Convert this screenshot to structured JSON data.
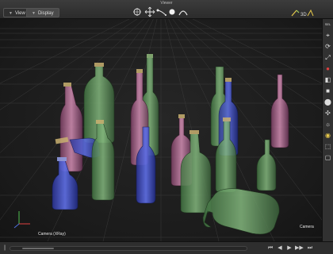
{
  "window": {
    "title": "Viewer"
  },
  "tabs": [
    {
      "label": "View"
    },
    {
      "label": "Display"
    }
  ],
  "toolbar": {
    "tools": [
      {
        "name": "orbit"
      },
      {
        "name": "move"
      },
      {
        "name": "curve"
      },
      {
        "name": "sphere"
      },
      {
        "name": "arc"
      }
    ],
    "indicator": "3D"
  },
  "viewport": {
    "camera_label": "Camera (XRay)",
    "camera_label_right": "Camera",
    "grid": true
  },
  "sidebar": {
    "items": [
      {
        "icon": "select-icon"
      },
      {
        "icon": "snap-icon"
      },
      {
        "icon": "rotate-icon"
      },
      {
        "icon": "scale-icon"
      },
      {
        "icon": "color-icon"
      },
      {
        "icon": "cube-icon"
      },
      {
        "icon": "cube-dark-icon"
      },
      {
        "icon": "sphere-icon"
      },
      {
        "icon": "transform-icon"
      },
      {
        "icon": "light-icon"
      },
      {
        "icon": "camera-icon"
      },
      {
        "icon": "region-icon"
      },
      {
        "icon": "frame-icon"
      }
    ]
  },
  "scrollbar": {
    "position": 0.05
  },
  "colors": {
    "green": "#6ea06a",
    "pink": "#c27ca0",
    "blue": "#3f4fc8",
    "accent": "#e6c84a"
  }
}
